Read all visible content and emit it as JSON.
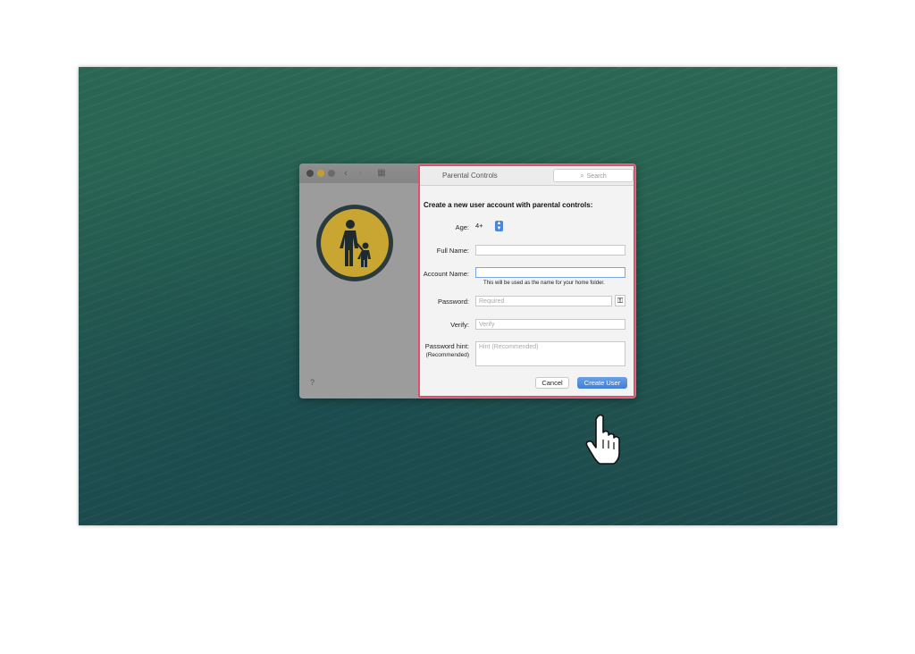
{
  "window": {
    "title": "Parental Controls",
    "search_placeholder": "Search",
    "help_label": "?"
  },
  "form": {
    "heading": "Create a new user account with parental controls:",
    "age_label": "Age:",
    "age_value": "4+",
    "full_name_label": "Full Name:",
    "full_name_value": "",
    "account_name_label": "Account Name:",
    "account_name_value": "",
    "account_name_hint": "This will be used as the name for your home folder.",
    "password_label": "Password:",
    "password_placeholder": "Required",
    "verify_label": "Verify:",
    "verify_placeholder": "Verify",
    "password_hint_label": "Password hint:",
    "password_hint_sublabel": "(Recommended)",
    "password_hint_placeholder": "Hint (Recommended)"
  },
  "buttons": {
    "cancel": "Cancel",
    "create": "Create User"
  },
  "icons": {
    "badge": "parental-controls-icon",
    "key": "key-icon",
    "cursor": "hand-pointer-icon"
  },
  "colors": {
    "highlight_border": "#e0506c",
    "primary_button": "#3f7fd8",
    "badge_yellow": "#c9a531"
  }
}
